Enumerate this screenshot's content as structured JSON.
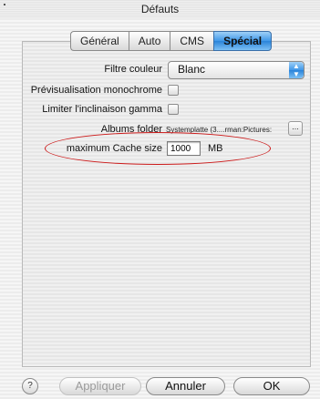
{
  "window": {
    "title": "Défauts"
  },
  "tabs": [
    {
      "label": "Général",
      "active": false
    },
    {
      "label": "Auto",
      "active": false
    },
    {
      "label": "CMS",
      "active": false
    },
    {
      "label": "Spécial",
      "active": true
    }
  ],
  "settings": {
    "filtre_couleur": {
      "label": "Filtre couleur",
      "value": "Blanc"
    },
    "previsualisation": {
      "label": "Prévisualisation monochrome",
      "checked": false
    },
    "limiter_gamma": {
      "label": "Limiter l'inclinaison gamma",
      "checked": false
    },
    "albums_folder": {
      "label": "Albums folder",
      "path": "Systemplatte (3....rman:Pictures:",
      "browse_label": "..."
    },
    "cache": {
      "label": "maximum Cache size",
      "value": "1000",
      "unit": "MB"
    }
  },
  "buttons": {
    "help": "?",
    "apply": "Appliquer",
    "cancel": "Annuler",
    "ok": "OK"
  },
  "colors": {
    "accent": "#3f97e8",
    "highlight_ring": "#cc1a1a"
  }
}
